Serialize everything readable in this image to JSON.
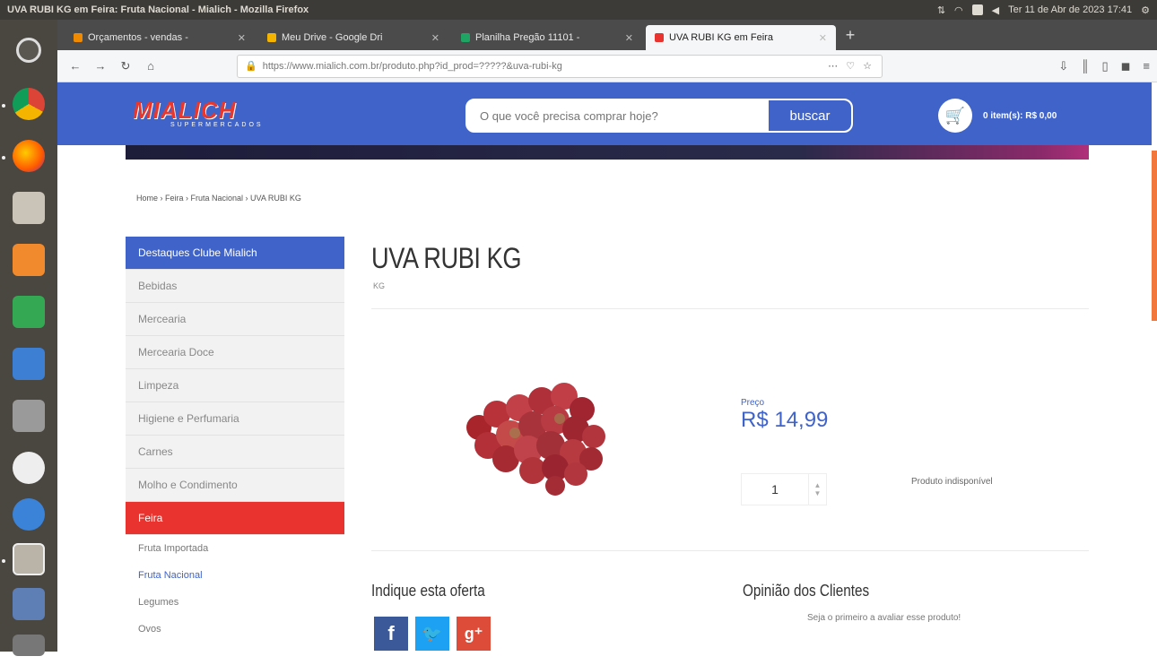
{
  "os": {
    "window_title": "UVA RUBI KG em Feira: Fruta Nacional - Mialich - Mozilla Firefox",
    "clock": "Ter 11 de Abr de 2023 17:41"
  },
  "browser": {
    "tabs": [
      {
        "label": "Orçamentos - vendas - ",
        "color": "#f08a00"
      },
      {
        "label": "Meu Drive - Google Dri",
        "color": "#f4b400"
      },
      {
        "label": "Planilha Pregão 11101 -",
        "color": "#1fa463"
      },
      {
        "label": "UVA RUBI KG em Feira",
        "color": "#e8332e",
        "active": true
      }
    ],
    "new_tab": "+",
    "url": "https://www.mialich.com.br/produto.php?id_prod=?????&uva-rubi-kg",
    "url_tools": "⋯ ♡ ☆"
  },
  "site": {
    "logo_text": "MIALICH",
    "logo_sub": "SUPERMERCADOS",
    "search_placeholder": "O que você precisa comprar hoje?",
    "search_button": "buscar",
    "cart_text": "0 item(s): R$ 0,00"
  },
  "breadcrumb": "Home  ›  Feira › Fruta Nacional  ›  UVA RUBI KG",
  "sidebar": {
    "header": "Destaques Clube Mialich",
    "categories": [
      "Bebidas",
      "Mercearia",
      "Mercearia Doce",
      "Limpeza",
      "Higiene e Perfumaria",
      "Carnes",
      "Molho e Condimento"
    ],
    "active": "Feira",
    "subcategories": [
      "Fruta Importada",
      "Fruta Nacional",
      "Legumes",
      "Ovos"
    ],
    "selected_sub": "Fruta Nacional"
  },
  "product": {
    "title": "UVA RUBI KG",
    "unit": "KG",
    "price_label": "Preço",
    "price": "R$ 14,99",
    "quantity": "1",
    "status": "Produto indisponível"
  },
  "share": {
    "title": "Indique esta oferta",
    "buttons": [
      {
        "icon": "facebook-icon",
        "glyph": "f",
        "color": "#3b5998"
      },
      {
        "icon": "twitter-icon",
        "glyph": "🐦",
        "color": "#1da1f2"
      },
      {
        "icon": "google-plus-icon",
        "glyph": "g⁺",
        "color": "#dd4b39"
      }
    ]
  },
  "opinions": {
    "title": "Opinião dos Clientes",
    "subtitle": "Seja o primeiro a avaliar esse produto!"
  }
}
